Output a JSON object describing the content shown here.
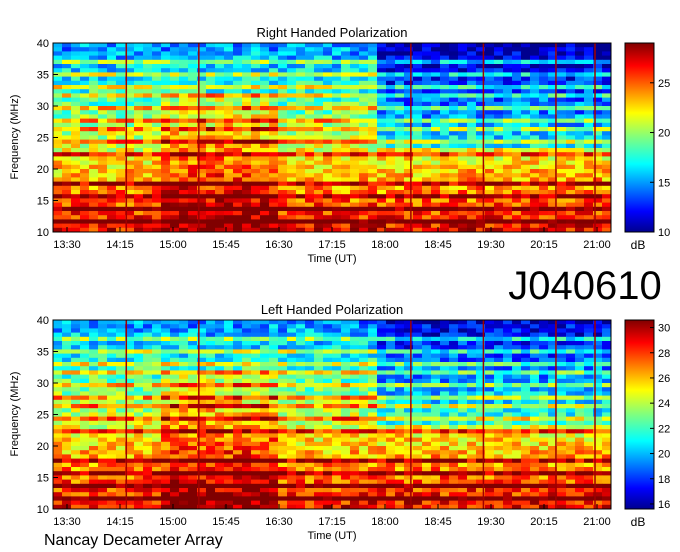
{
  "observation_id": "J040610",
  "footer_label": "Nancay Decameter Array",
  "chart_data": [
    {
      "type": "heatmap",
      "title": "Right Handed Polarization",
      "xlabel": "Time (UT)",
      "ylabel": "Frequency (MHz)",
      "x_ticks": [
        "13:30",
        "14:15",
        "15:00",
        "15:45",
        "16:30",
        "17:15",
        "18:00",
        "18:45",
        "19:30",
        "20:15",
        "21:00"
      ],
      "y_ticks": [
        10,
        15,
        20,
        25,
        30,
        35,
        40
      ],
      "ylim": [
        10,
        40
      ],
      "colorbar": {
        "label": "dB",
        "ticks": [
          10,
          15,
          20,
          25
        ],
        "range": [
          10,
          29
        ]
      }
    },
    {
      "type": "heatmap",
      "title": "Left Handed Polarization",
      "xlabel": "Time (UT)",
      "ylabel": "Frequency (MHz)",
      "x_ticks": [
        "13:30",
        "14:15",
        "15:00",
        "15:45",
        "16:30",
        "17:15",
        "18:00",
        "18:45",
        "19:30",
        "20:15",
        "21:00"
      ],
      "y_ticks": [
        10,
        15,
        20,
        25,
        30,
        35,
        40
      ],
      "ylim": [
        10,
        40
      ],
      "colorbar": {
        "label": "dB",
        "ticks": [
          16,
          18,
          20,
          22,
          24,
          26,
          28,
          30
        ],
        "range": [
          15.6,
          30.6
        ]
      }
    }
  ]
}
